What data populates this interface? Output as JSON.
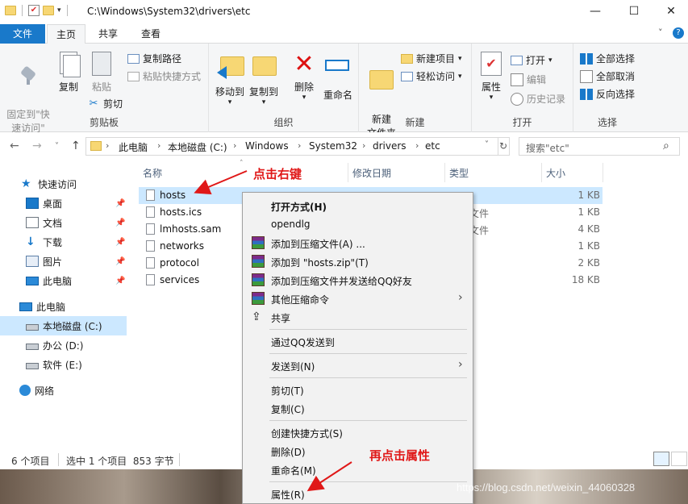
{
  "window": {
    "title": "C:\\Windows\\System32\\drivers\\etc",
    "minimize": "—",
    "maximize": "☐",
    "close": "✕"
  },
  "ribbon_tabs": {
    "file": "文件",
    "home": "主页",
    "share": "共享",
    "view": "查看"
  },
  "ribbon": {
    "clipboard": {
      "label": "剪贴板",
      "pin_quick_access": "固定到\"快\n速访问\"",
      "copy": "复制",
      "paste": "粘贴",
      "copy_path": "复制路径",
      "paste_shortcut": "粘贴快捷方式",
      "cut": "剪切"
    },
    "organize": {
      "label": "组织",
      "move_to": "移动到",
      "copy_to": "复制到",
      "delete": "删除",
      "rename": "重命名"
    },
    "new": {
      "label": "新建",
      "new_folder": "新建\n文件夹",
      "new_item": "新建项目",
      "easy_access": "轻松访问"
    },
    "open": {
      "label": "打开",
      "properties": "属性",
      "open": "打开",
      "edit": "编辑",
      "history": "历史记录"
    },
    "select": {
      "label": "选择",
      "select_all": "全部选择",
      "select_none": "全部取消",
      "invert": "反向选择"
    }
  },
  "address": {
    "crumbs": [
      "此电脑",
      "本地磁盘 (C:)",
      "Windows",
      "System32",
      "drivers",
      "etc"
    ],
    "search_placeholder": "搜索\"etc\""
  },
  "sidebar": {
    "items": [
      {
        "label": "快速访问",
        "icon": "star-icon"
      },
      {
        "label": "桌面",
        "icon": "desktop-icon",
        "pinned": true
      },
      {
        "label": "文档",
        "icon": "document-icon",
        "pinned": true
      },
      {
        "label": "下载",
        "icon": "download-icon",
        "pinned": true
      },
      {
        "label": "图片",
        "icon": "picture-icon",
        "pinned": true
      },
      {
        "label": "此电脑",
        "icon": "computer-icon",
        "pinned": true
      },
      {
        "label": "此电脑",
        "icon": "computer-icon"
      },
      {
        "label": "本地磁盘 (C:)",
        "icon": "drive-icon",
        "selected": true
      },
      {
        "label": "办公 (D:)",
        "icon": "drive-icon"
      },
      {
        "label": "软件 (E:)",
        "icon": "drive-icon"
      },
      {
        "label": "网络",
        "icon": "network-icon"
      }
    ]
  },
  "file_list": {
    "columns": {
      "name": "名称",
      "modified": "修改日期",
      "type": "类型",
      "size": "大小"
    },
    "rows": [
      {
        "name": "hosts",
        "type": "",
        "size": "1 KB",
        "selected": true
      },
      {
        "name": "hosts.ics",
        "type": "文件",
        "size": "1 KB"
      },
      {
        "name": "lmhosts.sam",
        "type": "文件",
        "size": "4 KB"
      },
      {
        "name": "networks",
        "type": "",
        "size": "1 KB"
      },
      {
        "name": "protocol",
        "type": "",
        "size": "2 KB"
      },
      {
        "name": "services",
        "type": "",
        "size": "18 KB"
      }
    ]
  },
  "status_bar": {
    "item_count": "6 个项目",
    "selection": "选中 1 个项目  853 字节"
  },
  "context_menu": {
    "items": [
      {
        "label": "打开方式(H)",
        "bold": true
      },
      {
        "label": "opendlg"
      },
      {
        "label": "添加到压缩文件(A) ...",
        "icon": "winrar-icon"
      },
      {
        "label": "添加到 \"hosts.zip\"(T)",
        "icon": "winrar-icon"
      },
      {
        "label": "添加到压缩文件并发送给QQ好友",
        "icon": "winrar-icon"
      },
      {
        "label": "其他压缩命令",
        "icon": "winrar-icon",
        "submenu": true
      },
      {
        "label": "共享",
        "icon": "share-icon"
      },
      {
        "label": "通过QQ发送到"
      },
      {
        "label": "发送到(N)",
        "submenu": true
      },
      {
        "label": "剪切(T)"
      },
      {
        "label": "复制(C)"
      },
      {
        "label": "创建快捷方式(S)"
      },
      {
        "label": "删除(D)"
      },
      {
        "label": "重命名(M)"
      },
      {
        "label": "属性(R)"
      }
    ]
  },
  "annotations": {
    "right_click": "点击右键",
    "properties": "再点击属性"
  },
  "watermark": "https://blog.csdn.net/weixin_44060328",
  "colors": {
    "accent": "#1979ca",
    "selection": "#cce8ff",
    "annotation": "#e01818"
  }
}
